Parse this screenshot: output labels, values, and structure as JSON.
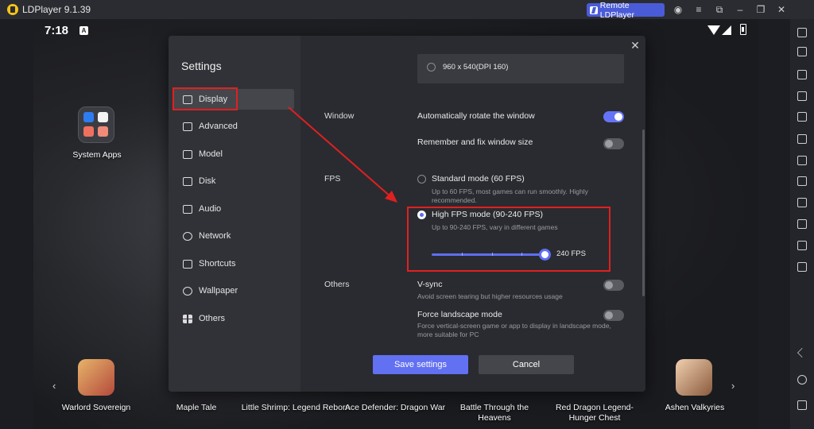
{
  "window": {
    "title": "LDPlayer 9.1.39",
    "remote_label": "Remote LDPlayer"
  },
  "android": {
    "time": "7:18",
    "status_letter": "A",
    "folder_label": "System Apps",
    "dock": [
      {
        "label": "Warlord Sovereign"
      },
      {
        "label": "Maple Tale"
      },
      {
        "label": "Little Shrimp: Legend Reborn"
      },
      {
        "label": "Ace Defender: Dragon War"
      },
      {
        "label": "Battle Through the Heavens"
      },
      {
        "label": "Red Dragon Legend-Hunger Chest"
      },
      {
        "label": "Ashen Valkyries"
      }
    ]
  },
  "settings": {
    "title": "Settings",
    "nav": [
      {
        "label": "Display",
        "icon": "monitor-icon",
        "active": true
      },
      {
        "label": "Advanced",
        "icon": "advanced-icon"
      },
      {
        "label": "Model",
        "icon": "folder-icon"
      },
      {
        "label": "Disk",
        "icon": "disk-icon"
      },
      {
        "label": "Audio",
        "icon": "headphones-icon"
      },
      {
        "label": "Network",
        "icon": "globe-icon"
      },
      {
        "label": "Shortcuts",
        "icon": "keyboard-icon"
      },
      {
        "label": "Wallpaper",
        "icon": "palette-icon"
      },
      {
        "label": "Others",
        "icon": "grid-icon"
      }
    ],
    "resolution_option": "960 x 540(DPI 160)",
    "window_section": "Window",
    "auto_rotate": {
      "label": "Automatically rotate the window",
      "on": true
    },
    "remember_size": {
      "label": "Remember and fix window size",
      "on": false
    },
    "fps_section": "FPS",
    "standard_mode": {
      "label": "Standard mode (60 FPS)",
      "desc_line1": "Up to 60 FPS, most games can run smoothly. Highly",
      "desc_line2": "recommended."
    },
    "high_mode": {
      "label": "High FPS mode (90-240 FPS)",
      "desc": "Up to 90-240 FPS, vary in different games",
      "selected": true
    },
    "fps_value_label": "240 FPS",
    "fps_slider_fraction": 1.0,
    "others_section": "Others",
    "vsync": {
      "label": "V-sync",
      "desc": "Avoid screen tearing but higher resources usage",
      "on": false
    },
    "landscape": {
      "label": "Force landscape mode",
      "desc_line1": "Force vertical-screen game or app to display in landscape mode,",
      "desc_line2": "more suitable for PC",
      "on": false
    },
    "save_label": "Save settings",
    "cancel_label": "Cancel"
  },
  "colors": {
    "accent": "#6270f2",
    "annotation": "#e02020"
  }
}
